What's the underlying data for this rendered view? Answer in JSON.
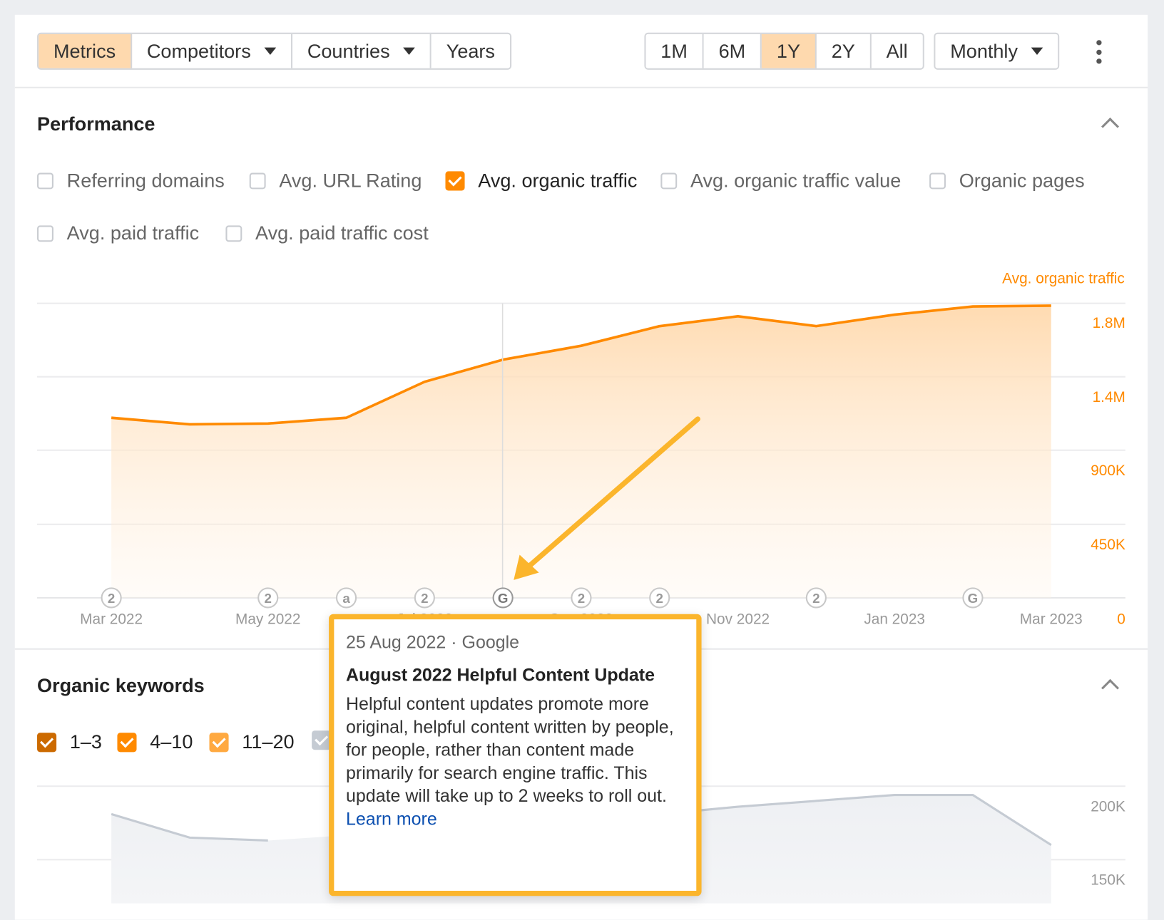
{
  "toolbar": {
    "left_buttons": [
      {
        "label": "Metrics",
        "active": true
      },
      {
        "label": "Competitors",
        "dropdown": true
      },
      {
        "label": "Countries",
        "dropdown": true
      },
      {
        "label": "Years"
      }
    ],
    "ranges": [
      {
        "label": "1M"
      },
      {
        "label": "6M"
      },
      {
        "label": "1Y",
        "active": true
      },
      {
        "label": "2Y"
      },
      {
        "label": "All"
      }
    ],
    "interval": {
      "label": "Monthly"
    },
    "more_icon": "kebab-vertical-icon"
  },
  "performance": {
    "title": "Performance",
    "collapse_icon": "chevron-up-icon",
    "metrics": [
      {
        "label": "Referring domains",
        "checked": false
      },
      {
        "label": "Avg. URL Rating",
        "checked": false
      },
      {
        "label": "Avg. organic traffic",
        "checked": true
      },
      {
        "label": "Avg. organic traffic value",
        "checked": false
      },
      {
        "label": "Organic pages",
        "checked": false
      },
      {
        "label": "Avg. paid traffic",
        "checked": false
      },
      {
        "label": "Avg. paid traffic cost",
        "checked": false
      }
    ],
    "accent": "#ff8a00"
  },
  "chart_data": [
    {
      "type": "area",
      "series_label": "Avg. organic traffic",
      "x": [
        "Mar 2022",
        "Apr 2022",
        "May 2022",
        "Jun 2022",
        "Jul 2022",
        "Aug 2022",
        "Sep 2022",
        "Oct 2022",
        "Nov 2022",
        "Dec 2022",
        "Jan 2023",
        "Feb 2023",
        "Mar 2023"
      ],
      "x_tick_labels": [
        "Mar 2022",
        "May 2022",
        "Jul 2022",
        "Sep 2022",
        "Nov 2022",
        "Jan 2023",
        "Mar 2023"
      ],
      "series": [
        {
          "name": "Avg. organic traffic",
          "color": "#ff8a00",
          "values": [
            1100000,
            1060000,
            1065000,
            1100000,
            1320000,
            1455000,
            1540000,
            1660000,
            1720000,
            1660000,
            1730000,
            1780000,
            1785000
          ]
        }
      ],
      "y_tick_labels": [
        "0",
        "450K",
        "900K",
        "1.4M",
        "1.8M"
      ],
      "ylim": [
        0,
        1800000
      ],
      "grid": true,
      "annotations": [
        {
          "month": "Mar 2022",
          "marker": "2"
        },
        {
          "month": "May 2022",
          "marker": "2"
        },
        {
          "month": "Jun 2022",
          "marker": "a"
        },
        {
          "month": "Jul 2022",
          "marker": "2"
        },
        {
          "month": "Aug 2022",
          "marker": "G",
          "highlighted": true
        },
        {
          "month": "Sep 2022",
          "marker": "2"
        },
        {
          "month": "Oct 2022",
          "marker": "2"
        },
        {
          "month": "Dec 2022",
          "marker": "2"
        },
        {
          "month": "Feb 2023",
          "marker": "G"
        }
      ]
    },
    {
      "type": "area",
      "x": [
        "Mar 2022",
        "Apr 2022",
        "May 2022",
        "Jun 2022",
        "Jul 2022",
        "Aug 2022",
        "Sep 2022",
        "Oct 2022",
        "Nov 2022",
        "Dec 2022",
        "Jan 2023",
        "Feb 2023",
        "Mar 2023"
      ],
      "series": [
        {
          "color": "#c5cbd3",
          "values": [
            181000,
            165000,
            163000,
            null,
            null,
            null,
            null,
            181000,
            186000,
            190000,
            194000,
            194000,
            160000
          ]
        }
      ],
      "y_tick_labels": [
        "150K",
        "200K"
      ],
      "ylim_visible": [
        150000,
        200000
      ],
      "grid": true
    }
  ],
  "tooltip": {
    "date": "25 Aug 2022 · Google",
    "title": "August 2022 Helpful Content Update",
    "body": "Helpful content updates promote more original, helpful content written by people, for people, rather than content made primarily for search engine traffic. This update will take up to 2 weeks to roll out.",
    "link": "Learn more",
    "border_color": "#fbb52c"
  },
  "organic_keywords": {
    "title": "Organic keywords",
    "collapse_icon": "chevron-up-icon",
    "positions": [
      {
        "label": "1–3",
        "color": "#cc6a00",
        "checked": true
      },
      {
        "label": "4–10",
        "color": "#ff8a00",
        "checked": true
      },
      {
        "label": "11–20",
        "color": "#ffa940",
        "checked": true
      },
      {
        "label": "",
        "color": "#c5cbd3",
        "checked": true
      }
    ]
  }
}
